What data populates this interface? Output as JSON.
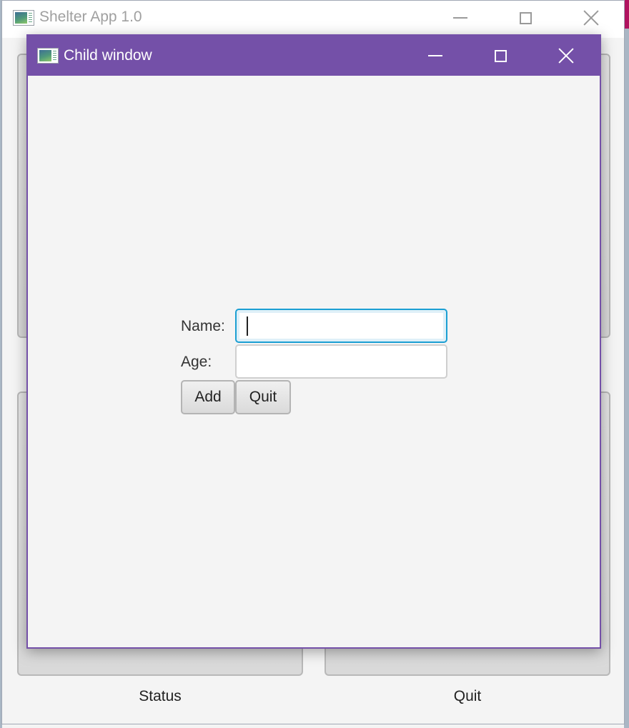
{
  "main_window": {
    "title": "Shelter App 1.0",
    "icon": "app-window-icon",
    "caption_buttons": [
      "minimize",
      "maximize",
      "close"
    ],
    "buttons": [
      {
        "label": "",
        "name": "top-left-button"
      },
      {
        "label": "",
        "name": "top-right-button"
      },
      {
        "label": "",
        "name": "bottom-left-button"
      },
      {
        "label": "",
        "name": "bottom-right-button"
      }
    ],
    "bottom_labels": [
      "Status",
      "Quit"
    ]
  },
  "child_window": {
    "title": "Child window",
    "icon": "app-window-icon",
    "accent_color": "#7450a8",
    "form": {
      "name_label": "Name:",
      "name_value": "",
      "age_label": "Age:",
      "age_value": "",
      "add_label": "Add",
      "quit_label": "Quit"
    }
  }
}
